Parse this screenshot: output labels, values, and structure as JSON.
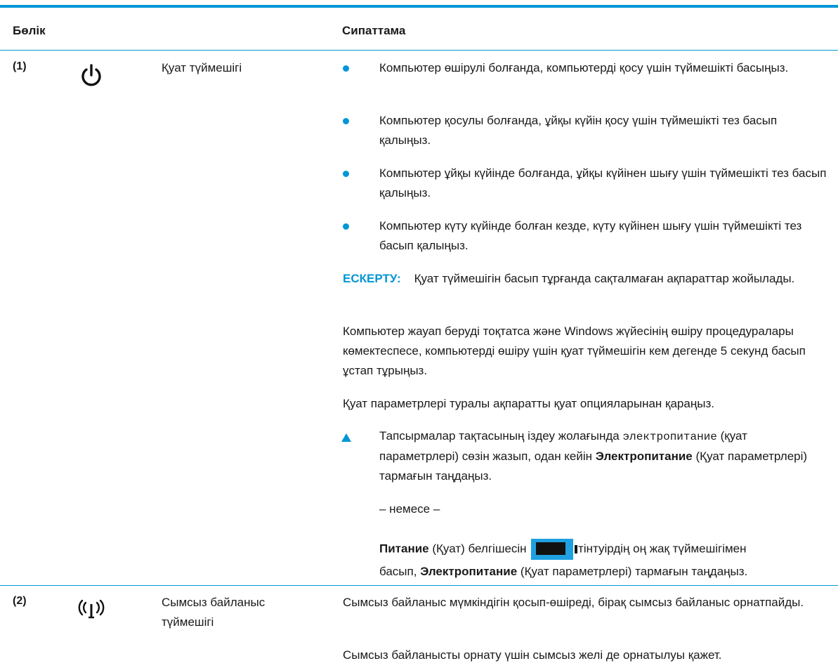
{
  "header": {
    "col_part": "Бөлік",
    "col_desc": "Сипаттама"
  },
  "rows": [
    {
      "num": "(1)",
      "icon": "power-icon",
      "name": "Қуат түймешігі",
      "bullets": [
        "Компьютер өшірулі болғанда, компьютерді қосу үшін түймешікті басыңыз.",
        "Компьютер қосулы болғанда, ұйқы күйін қосу үшін түймешікті тез басып қалыңыз.",
        "Компьютер ұйқы күйінде болғанда, ұйқы күйінен шығу үшін түймешікті тез басып қалыңыз.",
        "Компьютер күту күйінде болған кезде, күту күйінен шығу үшін түймешікті тез басып қалыңыз."
      ],
      "note_label": "ЕСКЕРТУ:",
      "note_text": "Қуат түймешігін басып тұрғанда сақталмаған ақпараттар жойылады.",
      "para1": "Компьютер жауап беруді тоқтатса және Windows жүйесінің өшіру процедуралары көмектеспесе, компьютерді өшіру үшін қуат түймешігін кем дегенде 5 секунд басып ұстап тұрыңыз.",
      "para2": "Қуат параметрлері туралы ақпаратты қуат опцияларынан қараңыз.",
      "step_pre": "Тапсырмалар тақтасының іздеу жолағында",
      "step_code": "электропитание",
      "step_mid": "(қуат параметрлері) сөзін жазып, одан кейін",
      "step_bold": "Электропитание",
      "step_post": "(Қуат параметрлері) тармағын таңдаңыз.",
      "or": "– немесе –",
      "alt_bold": "Питание",
      "alt_mid": "(Қуат) белгішесін",
      "alt_post": "тінтуірдің оң жақ түймешігімен",
      "alt2_pre": "басып,",
      "alt2_bold": "Электропитание",
      "alt2_post": "(Қуат параметрлері) тармағын таңдаңыз."
    },
    {
      "num": "(2)",
      "icon": "wireless-icon",
      "name": "Сымсыз байланыс түймешігі",
      "desc1": "Сымсыз байланыс мүмкіндігін қосып-өшіреді, бірақ сымсыз байланыс орнатпайды.",
      "desc2": "Сымсыз байланысты орнату үшін сымсыз желі де орнатылуы қажет."
    }
  ],
  "colors": {
    "accent": "#0096d6"
  }
}
